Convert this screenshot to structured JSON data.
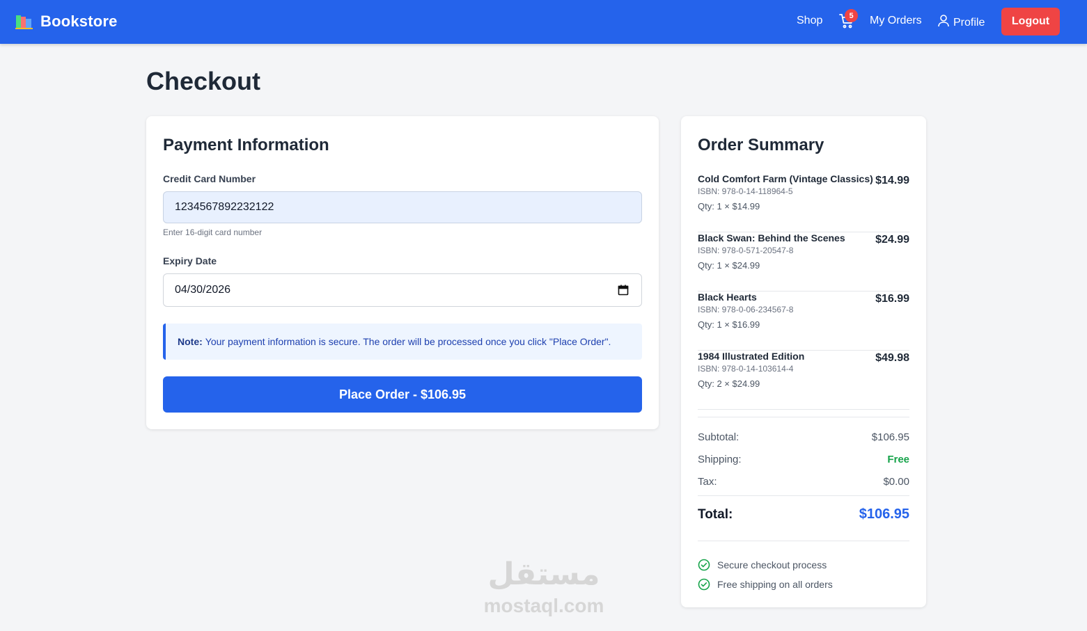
{
  "header": {
    "brand": "Bookstore",
    "nav": {
      "shop": "Shop",
      "orders": "My Orders",
      "profile": "Profile",
      "logout": "Logout"
    },
    "cart_count": "5",
    "colors": {
      "primary": "#2563eb",
      "danger": "#ef4444"
    }
  },
  "page": {
    "title": "Checkout"
  },
  "payment": {
    "title": "Payment Information",
    "cc_label": "Credit Card Number",
    "cc_value": "1234567892232122",
    "cc_help": "Enter 16-digit card number",
    "expiry_label": "Expiry Date",
    "expiry_value": "04/30/2026",
    "note_label": "Note:",
    "note_text": "Your payment information is secure. The order will be processed once you click \"Place Order\".",
    "place_order": "Place Order - $106.95"
  },
  "summary": {
    "title": "Order Summary",
    "items": [
      {
        "name": "Cold Comfort Farm (Vintage Classics)",
        "isbn": "ISBN: 978-0-14-118964-5",
        "qty": "Qty: 1 × $14.99",
        "total": "$14.99"
      },
      {
        "name": "Black Swan: Behind the Scenes",
        "isbn": "ISBN: 978-0-571-20547-8",
        "qty": "Qty: 1 × $24.99",
        "total": "$24.99"
      },
      {
        "name": "Black Hearts",
        "isbn": "ISBN: 978-0-06-234567-8",
        "qty": "Qty: 1 × $16.99",
        "total": "$16.99"
      },
      {
        "name": "1984 Illustrated Edition",
        "isbn": "ISBN: 978-0-14-103614-4",
        "qty": "Qty: 2 × $24.99",
        "total": "$49.98"
      }
    ],
    "subtotal_label": "Subtotal:",
    "subtotal_value": "$106.95",
    "shipping_label": "Shipping:",
    "shipping_value": "Free",
    "tax_label": "Tax:",
    "tax_value": "$0.00",
    "total_label": "Total:",
    "total_value": "$106.95",
    "features": [
      "Secure checkout process",
      "Free shipping on all orders"
    ]
  },
  "watermark": {
    "arabic": "مستقل",
    "latin": "mostaql.com"
  }
}
